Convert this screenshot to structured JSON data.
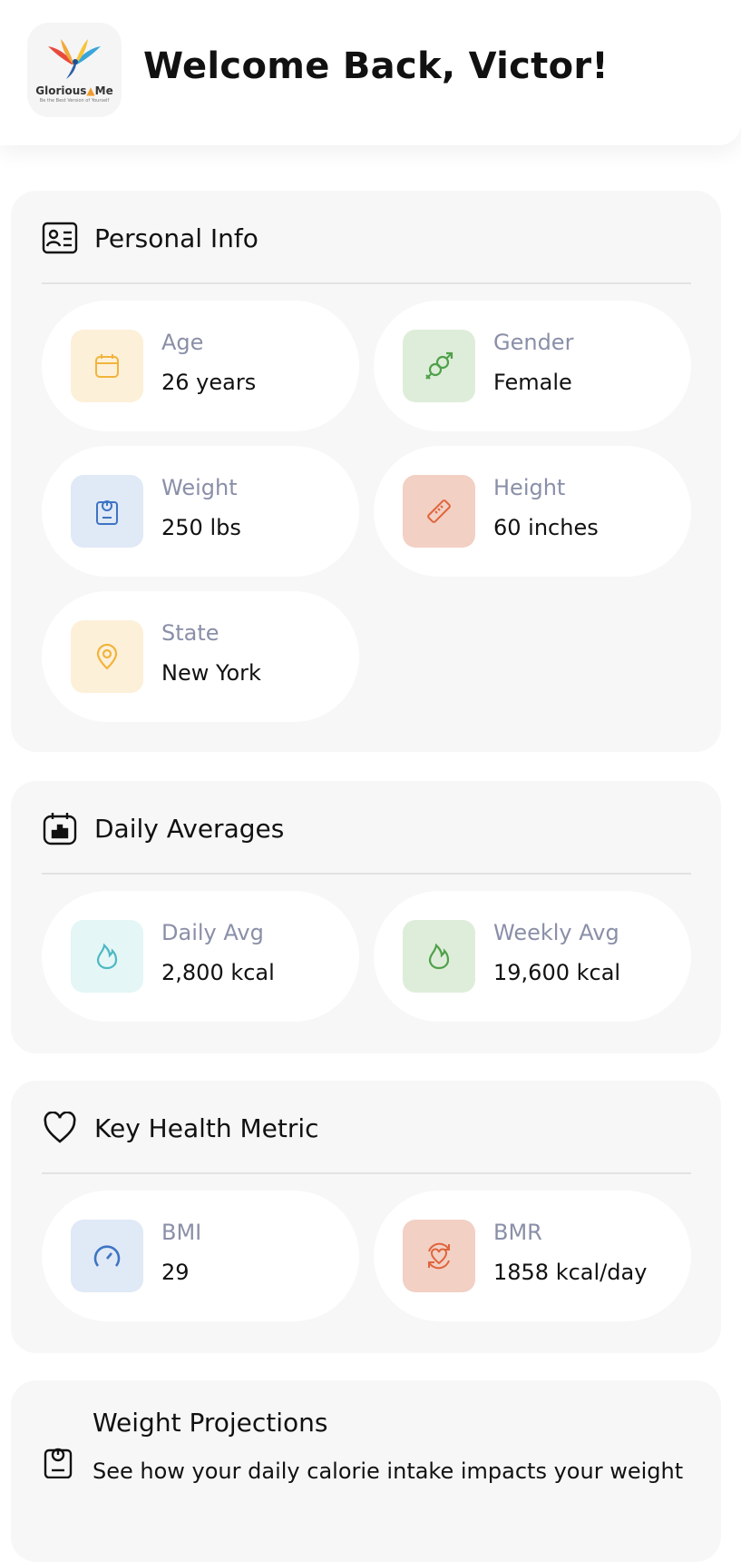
{
  "header": {
    "welcome": "Welcome Back, Victor!",
    "logo_name_left": "Glorious",
    "logo_name_right": "Me",
    "logo_tagline": "Be the Best Version of Yourself"
  },
  "personal_info": {
    "title": "Personal Info",
    "items": [
      {
        "label": "Age",
        "value": "26 years",
        "icon": "calendar-icon",
        "bg": "#fdf0d9",
        "color": "#f0b43c"
      },
      {
        "label": "Gender",
        "value": "Female",
        "icon": "gender-icon",
        "bg": "#deedd9",
        "color": "#4fa04a"
      },
      {
        "label": "Weight",
        "value": "250 lbs",
        "icon": "scale-icon",
        "bg": "#e0e9f6",
        "color": "#3d74c4"
      },
      {
        "label": "Height",
        "value": "60 inches",
        "icon": "ruler-icon",
        "bg": "#f2d0c4",
        "color": "#e0643c"
      },
      {
        "label": "State",
        "value": "New York",
        "icon": "location-pin-icon",
        "bg": "#fdf0d9",
        "color": "#f0b43c"
      }
    ]
  },
  "daily_averages": {
    "title": "Daily Averages",
    "items": [
      {
        "label": "Daily Avg",
        "value": "2,800 kcal",
        "icon": "flame-icon",
        "bg": "#e4f6f6",
        "color": "#4db8c4"
      },
      {
        "label": "Weekly Avg",
        "value": "19,600 kcal",
        "icon": "flame-icon",
        "bg": "#deedd9",
        "color": "#4fa04a"
      }
    ]
  },
  "key_health_metric": {
    "title": "Key Health Metric",
    "items": [
      {
        "label": "BMI",
        "value": "29",
        "icon": "gauge-icon",
        "bg": "#e0e9f6",
        "color": "#3d74c4"
      },
      {
        "label": "BMR",
        "value": "1858 kcal/day",
        "icon": "heart-cycle-icon",
        "bg": "#f2d0c4",
        "color": "#e0643c"
      }
    ]
  },
  "weight_projections": {
    "title": "Weight Projections",
    "description": "See how your daily calorie intake impacts your weight"
  }
}
